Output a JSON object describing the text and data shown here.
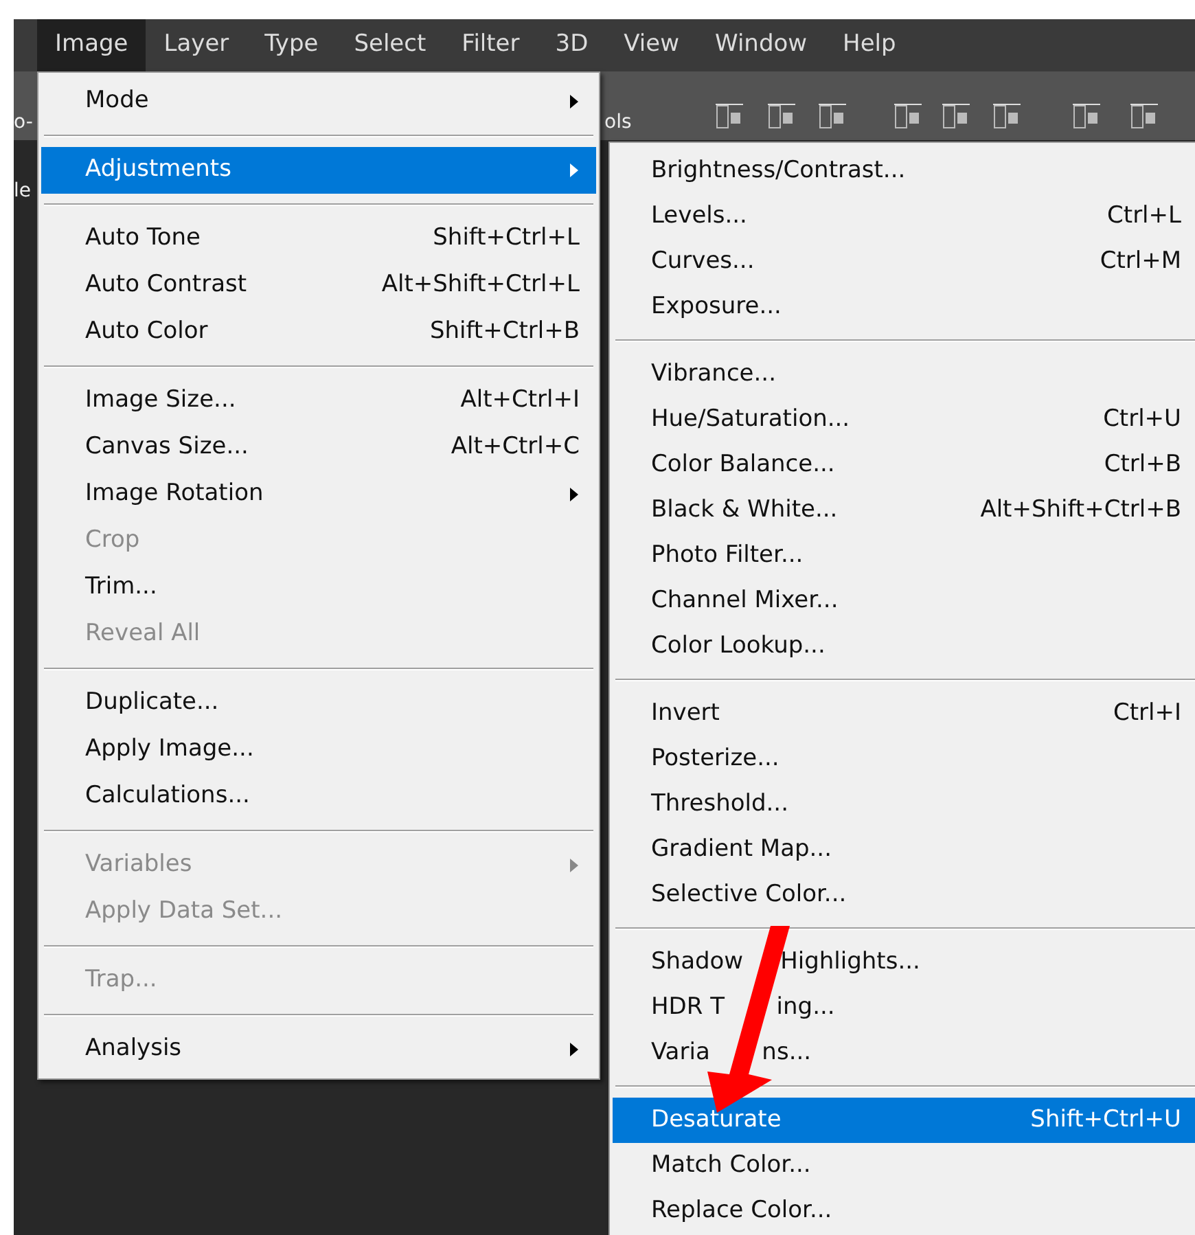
{
  "menu_bar": [
    {
      "label": "Image",
      "selected": true
    },
    {
      "label": "Layer",
      "selected": false
    },
    {
      "label": "Type",
      "selected": false
    },
    {
      "label": "Select",
      "selected": false
    },
    {
      "label": "Filter",
      "selected": false
    },
    {
      "label": "3D",
      "selected": false
    },
    {
      "label": "View",
      "selected": false
    },
    {
      "label": "Window",
      "selected": false
    },
    {
      "label": "Help",
      "selected": false
    }
  ],
  "background": {
    "toolbar_fragment": "ols",
    "left_fragments": [
      "o-",
      "le"
    ]
  },
  "image_menu": [
    {
      "kind": "item",
      "label": "Mode",
      "submenu": true,
      "selected": false,
      "disabled": false
    },
    {
      "kind": "separator"
    },
    {
      "kind": "item",
      "label": "Adjustments",
      "submenu": true,
      "selected": true,
      "disabled": false
    },
    {
      "kind": "separator"
    },
    {
      "kind": "item",
      "label": "Auto Tone",
      "shortcut": "Shift+Ctrl+L",
      "selected": false,
      "disabled": false
    },
    {
      "kind": "item",
      "label": "Auto Contrast",
      "shortcut": "Alt+Shift+Ctrl+L",
      "selected": false,
      "disabled": false
    },
    {
      "kind": "item",
      "label": "Auto Color",
      "shortcut": "Shift+Ctrl+B",
      "selected": false,
      "disabled": false
    },
    {
      "kind": "separator"
    },
    {
      "kind": "item",
      "label": "Image Size...",
      "shortcut": "Alt+Ctrl+I",
      "selected": false,
      "disabled": false
    },
    {
      "kind": "item",
      "label": "Canvas Size...",
      "shortcut": "Alt+Ctrl+C",
      "selected": false,
      "disabled": false
    },
    {
      "kind": "item",
      "label": "Image Rotation",
      "submenu": true,
      "selected": false,
      "disabled": false
    },
    {
      "kind": "item",
      "label": "Crop",
      "selected": false,
      "disabled": true
    },
    {
      "kind": "item",
      "label": "Trim...",
      "selected": false,
      "disabled": false
    },
    {
      "kind": "item",
      "label": "Reveal All",
      "selected": false,
      "disabled": true
    },
    {
      "kind": "separator"
    },
    {
      "kind": "item",
      "label": "Duplicate...",
      "selected": false,
      "disabled": false
    },
    {
      "kind": "item",
      "label": "Apply Image...",
      "selected": false,
      "disabled": false
    },
    {
      "kind": "item",
      "label": "Calculations...",
      "selected": false,
      "disabled": false
    },
    {
      "kind": "separator"
    },
    {
      "kind": "item",
      "label": "Variables",
      "submenu": true,
      "selected": false,
      "disabled": true
    },
    {
      "kind": "item",
      "label": "Apply Data Set...",
      "selected": false,
      "disabled": true
    },
    {
      "kind": "separator"
    },
    {
      "kind": "item",
      "label": "Trap...",
      "selected": false,
      "disabled": true
    },
    {
      "kind": "separator"
    },
    {
      "kind": "item",
      "label": "Analysis",
      "submenu": true,
      "selected": false,
      "disabled": false
    }
  ],
  "adjustments_menu": [
    {
      "kind": "item",
      "label": "Brightness/Contrast...",
      "selected": false
    },
    {
      "kind": "item",
      "label": "Levels...",
      "shortcut": "Ctrl+L",
      "selected": false
    },
    {
      "kind": "item",
      "label": "Curves...",
      "shortcut": "Ctrl+M",
      "selected": false
    },
    {
      "kind": "item",
      "label": "Exposure...",
      "selected": false
    },
    {
      "kind": "separator"
    },
    {
      "kind": "item",
      "label": "Vibrance...",
      "selected": false
    },
    {
      "kind": "item",
      "label": "Hue/Saturation...",
      "shortcut": "Ctrl+U",
      "selected": false
    },
    {
      "kind": "item",
      "label": "Color Balance...",
      "shortcut": "Ctrl+B",
      "selected": false
    },
    {
      "kind": "item",
      "label": "Black & White...",
      "shortcut": "Alt+Shift+Ctrl+B",
      "selected": false
    },
    {
      "kind": "item",
      "label": "Photo Filter...",
      "selected": false
    },
    {
      "kind": "item",
      "label": "Channel Mixer...",
      "selected": false
    },
    {
      "kind": "item",
      "label": "Color Lookup...",
      "selected": false
    },
    {
      "kind": "separator"
    },
    {
      "kind": "item",
      "label": "Invert",
      "shortcut": "Ctrl+I",
      "selected": false
    },
    {
      "kind": "item",
      "label": "Posterize...",
      "selected": false
    },
    {
      "kind": "item",
      "label": "Threshold...",
      "selected": false
    },
    {
      "kind": "item",
      "label": "Gradient Map...",
      "selected": false
    },
    {
      "kind": "item",
      "label": "Selective Color...",
      "selected": false
    },
    {
      "kind": "separator"
    },
    {
      "kind": "item",
      "label": "Shadow     Highlights...",
      "selected": false
    },
    {
      "kind": "item",
      "label": "HDR T       ing...",
      "selected": false
    },
    {
      "kind": "item",
      "label": "Varia       ns...",
      "selected": false
    },
    {
      "kind": "separator"
    },
    {
      "kind": "item",
      "label": "Desaturate",
      "shortcut": "Shift+Ctrl+U",
      "selected": true
    },
    {
      "kind": "item",
      "label": "Match Color...",
      "selected": false
    },
    {
      "kind": "item",
      "label": "Replace Color...",
      "selected": false
    }
  ]
}
